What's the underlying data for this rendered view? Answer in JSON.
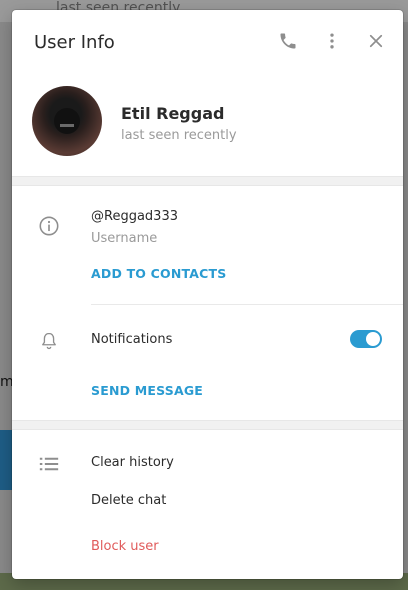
{
  "background": {
    "top_text": "last seen recently",
    "left_glyph": "m+"
  },
  "dialog": {
    "title": "User Info",
    "header_icons": [
      "phone-icon",
      "more-vertical-icon",
      "close-icon"
    ]
  },
  "profile": {
    "name": "Etil Reggad",
    "status": "last seen recently",
    "avatar_icon": "profile-photo"
  },
  "info": {
    "username": "@Reggad333",
    "username_label": "Username",
    "add_to_contacts": "ADD TO CONTACTS"
  },
  "notifications": {
    "label": "Notifications",
    "enabled": true,
    "send_message": "SEND MESSAGE"
  },
  "actions": {
    "clear_history": "Clear history",
    "delete_chat": "Delete chat",
    "block_user": "Block user"
  },
  "colors": {
    "accent": "#2a9bd1",
    "danger": "#e05a5a",
    "muted_text": "#9a9a9a",
    "primary_text": "#2b2b2b"
  }
}
